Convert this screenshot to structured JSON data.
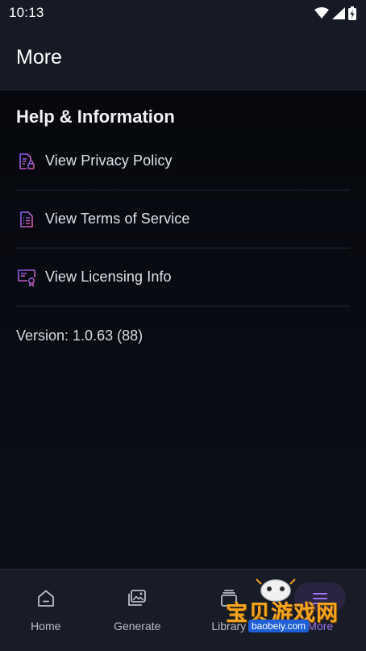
{
  "status_bar": {
    "time": "10:13"
  },
  "app_bar": {
    "title": "More"
  },
  "section": {
    "title": "Help & Information"
  },
  "menu": {
    "items": [
      {
        "label": "View Privacy Policy",
        "icon": "privacy-document-icon"
      },
      {
        "label": "View Terms of Service",
        "icon": "terms-document-icon"
      },
      {
        "label": "View Licensing Info",
        "icon": "license-certificate-icon"
      }
    ]
  },
  "version_text": "Version: 1.0.63 (88)",
  "bottom_nav": {
    "items": [
      {
        "label": "Home",
        "icon": "home-icon"
      },
      {
        "label": "Generate",
        "icon": "image-stack-icon"
      },
      {
        "label": "Library",
        "icon": "library-icon"
      },
      {
        "label": "More",
        "icon": "menu-icon"
      }
    ],
    "active": "More"
  },
  "watermark": {
    "text": "宝贝游戏网",
    "url": "baobeiy.com"
  },
  "colors": {
    "accent": "#a074f0",
    "icon_gradient_start": "#7c5cf0",
    "icon_gradient_end": "#e05aa6",
    "background": "#07090e",
    "bar_background": "#151a24"
  }
}
